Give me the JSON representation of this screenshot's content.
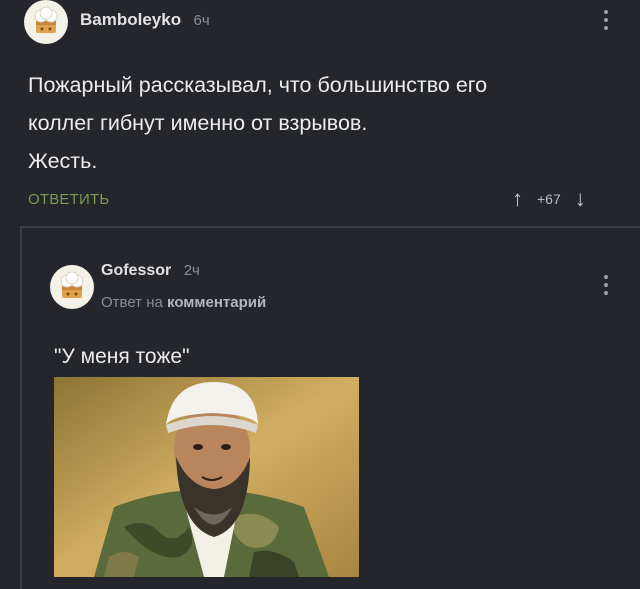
{
  "comment1": {
    "author": "Bamboleyko",
    "time": "6ч",
    "avatar_icon": "chef-hat-icon",
    "lines": [
      "Пожарный рассказывал, что большинство его",
      "коллег гибнут именно от взрывов.",
      "Жесть."
    ],
    "reply_label": "ОТВЕТИТЬ",
    "rating": "+67"
  },
  "comment2": {
    "author": "Gofessor",
    "time": "2ч",
    "avatar_icon": "chef-hat-icon",
    "reply_prefix": "Ответ на",
    "reply_target": "комментарий",
    "text": "\"У меня тоже\""
  },
  "colors": {
    "background": "#24262b",
    "accent_green": "#7a9a55",
    "muted": "#8a8d93"
  }
}
